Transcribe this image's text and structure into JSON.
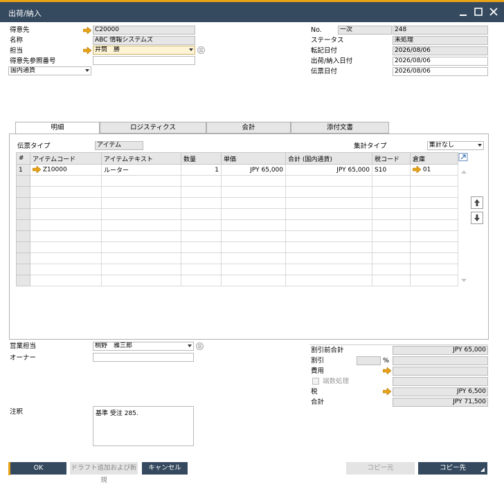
{
  "window": {
    "title": "出荷/納入"
  },
  "header_left": {
    "customer_label": "得意先",
    "customer_value": "C20000",
    "name_label": "名称",
    "name_value": "ABC 情報システムズ",
    "contact_label": "担当",
    "contact_value": "井筒　勝",
    "ref_label": "得意先参照番号",
    "ref_value": "",
    "currency_value": "国内通貨"
  },
  "header_right": {
    "no_label": "No.",
    "series_value": "一次",
    "no_value": "248",
    "status_label": "ステータス",
    "status_value": "未処理",
    "posting_label": "転記日付",
    "posting_value": "2026/08/06",
    "delivery_label": "出荷/納入日付",
    "delivery_value": "2026/08/06",
    "doc_label": "伝票日付",
    "doc_value": "2026/08/06"
  },
  "tabs": [
    "明細",
    "ロジスティクス",
    "会計",
    "添付文書"
  ],
  "contents": {
    "doc_type_label": "伝票タイプ",
    "doc_type_value": "アイテム",
    "summary_label": "集計タイプ",
    "summary_value": "集計なし"
  },
  "grid": {
    "columns": [
      "#",
      "アイテムコード",
      "アイテムテキスト",
      "数量",
      "単価",
      "合計 (国内通貨)",
      "税コード",
      "倉庫"
    ],
    "rows": [
      {
        "num": "1",
        "item_code": "Z10000",
        "item_text": "ルーター",
        "qty": "1",
        "price": "JPY 65,000",
        "total": "JPY 65,000",
        "tax": "S10",
        "warehouse": "01"
      }
    ]
  },
  "footer_left": {
    "sales_emp_label": "営業担当",
    "sales_emp_value": "桐野　雅三郎",
    "owner_label": "オーナー",
    "owner_value": "",
    "remarks_label": "注釈",
    "remarks_value": "基準 受注 285."
  },
  "totals": {
    "before_disc_label": "割引前合計",
    "before_disc_value": "JPY 65,000",
    "discount_label": "割引",
    "discount_pct": "",
    "percent_sign": "%",
    "discount_value": "",
    "freight_label": "費用",
    "freight_value": "",
    "rounding_label": "端数処理",
    "rounding_value": "",
    "tax_label": "税",
    "tax_value": "JPY 6,500",
    "total_label": "合計",
    "total_value": "JPY 71,500"
  },
  "buttons": {
    "ok": "OK",
    "add_draft": "ドラフト追加および新規",
    "cancel": "キャンセル",
    "copy_from": "コピー元",
    "copy_to": "コピー先"
  },
  "colors": {
    "titlebar": "#354a5f",
    "accent": "#e8a317",
    "link_arrow": "#e8a317"
  }
}
